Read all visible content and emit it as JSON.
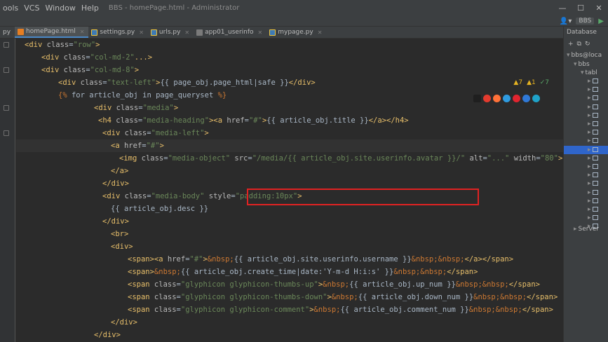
{
  "menubar": {
    "items": [
      "ools",
      "VCS",
      "Window",
      "Help"
    ],
    "window_title": "BBS - homePage.html - Administrator"
  },
  "window_controls": {
    "minimize": "—",
    "maximize": "☐",
    "close": "✕"
  },
  "toolbar": {
    "config_label": "BBS",
    "run_icon": "run-icon",
    "user_icon": "user-icon"
  },
  "tabs": [
    {
      "label": "py",
      "icon": "python-icon",
      "active": false
    },
    {
      "label": "homePage.html",
      "icon": "html-icon",
      "active": true
    },
    {
      "label": "settings.py",
      "icon": "python-icon",
      "active": false
    },
    {
      "label": "urls.py",
      "icon": "python-icon",
      "active": false
    },
    {
      "label": "app01_userinfo",
      "icon": "table-icon",
      "active": false
    },
    {
      "label": "mypage.py",
      "icon": "python-icon",
      "active": false
    }
  ],
  "inspections": {
    "warnings": "▲7",
    "weak": "▲1",
    "ok": "✓7"
  },
  "code_lines": [
    "<div class=\"row\">",
    "<div class=\"col-md-2\"...>",
    "<div class=\"col-md-8\">",
    "<div class=\"text-left\">{{ page_obj.page_html|safe }}</div>",
    "{% for article_obj in page_queryset %}",
    "<div class=\"media\">",
    "<h4 class=\"media-heading\"><a href=\"#\">{{ article_obj.title }}</a></h4>",
    "<div class=\"media-left\">",
    "<a href=\"#\">",
    "<img class=\"media-object\" src=\"/media/{{ article_obj.site.userinfo.avatar }}/\" alt=\"...\" width=\"80\">",
    "</a>",
    "</div>",
    "<div class=\"media-body\" style=\"padding:10px\">",
    "{{ article_obj.desc }}",
    "</div>",
    "<br>",
    "<div>",
    "<span><a href=\"#\">&nbsp;{{ article_obj.site.userinfo.username }}&nbsp;&nbsp;</a></span>",
    "<span>&nbsp;{{ article_obj.create_time|date:'Y-m-d H:i:s' }}&nbsp;&nbsp;</span>",
    "<span class=\"glyphicon glyphicon-thumbs-up\">&nbsp;{{ article_obj.up_num }}&nbsp;&nbsp;</span>",
    "<span class=\"glyphicon glyphicon-thumbs-down\">&nbsp;{{ article_obj.down_num }}&nbsp;&nbsp;</span>",
    "<span class=\"glyphicon glyphicon-comment\">&nbsp;{{ article_obj.comment_num }}&nbsp;&nbsp;</span>",
    "</div>",
    "</div>"
  ],
  "db_panel": {
    "title": "Database",
    "tree": {
      "datasource": "bbs@loca",
      "schema": "bbs",
      "tables_folder": "tabl",
      "server_folder": "Server"
    }
  }
}
